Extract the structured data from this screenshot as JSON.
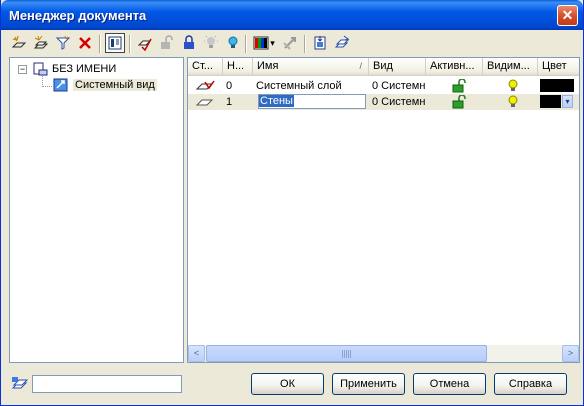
{
  "window": {
    "title": "Менеджер документа",
    "close_glyph": "✕"
  },
  "toolbar": {
    "icons": [
      "new-layer-icon",
      "new-sublayer-icon",
      "filter-icon",
      "delete-icon",
      "panel-view-icon",
      "set-current-icon",
      "unlock-icon",
      "lock-icon",
      "light-off-icon",
      "light-on-icon",
      "color-picker-icon",
      "move-icon",
      "import-icon",
      "export-icon"
    ],
    "color_dropdown_arrow": "▾"
  },
  "tree": {
    "root": {
      "label": "БЕЗ ИМЕНИ",
      "expander": "−"
    },
    "child": {
      "label": "Системный вид"
    }
  },
  "grid": {
    "columns": [
      "Ст...",
      "Н...",
      "Имя",
      "Вид",
      "Активн...",
      "Видим...",
      "Цвет"
    ],
    "sort_indicator": "/",
    "rows": [
      {
        "state_icon": "current-layer-icon",
        "number": "0",
        "name": "Системный слой",
        "view": "0 Системн",
        "active_icon": "unlocked-icon",
        "visible_icon": "bulb-on-icon",
        "color": "#000000"
      },
      {
        "state_icon": "layer-icon",
        "number": "1",
        "name": "Стены",
        "view": "0 Системн",
        "active_icon": "unlocked-icon",
        "visible_icon": "bulb-on-icon",
        "color": "#000000",
        "color_dropdown": "▾"
      }
    ],
    "scroll_left": "<",
    "scroll_right": ">"
  },
  "bottom": {
    "input_value": ""
  },
  "buttons": {
    "ok": "ОК",
    "apply": "Применить",
    "cancel": "Отмена",
    "help": "Справка"
  },
  "colors": {
    "accent": "#0058e6",
    "selection": "#316ac5",
    "row_highlight": "#ece9d8"
  }
}
